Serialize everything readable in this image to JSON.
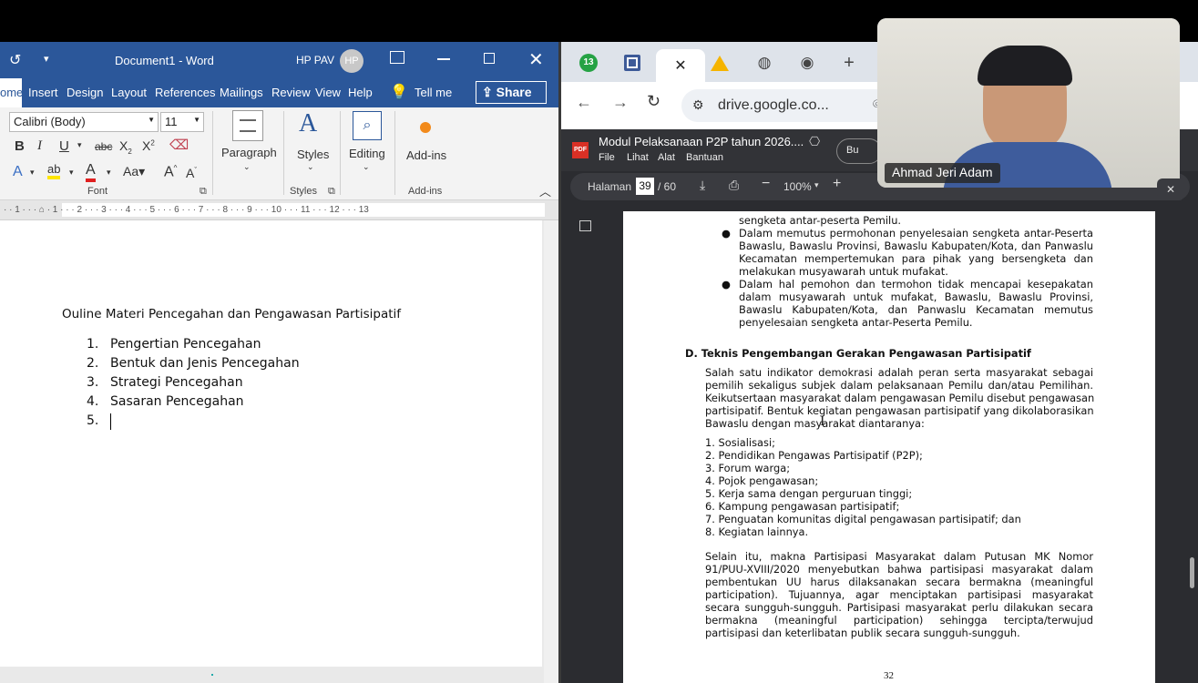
{
  "word": {
    "title": "Document1  -  Word",
    "user": "HP PAV",
    "avatar": "HP",
    "tabs": [
      "ome",
      "Insert",
      "Design",
      "Layout",
      "References",
      "Mailings",
      "Review",
      "View",
      "Help"
    ],
    "tell_me": "Tell me",
    "share": "Share",
    "font_name": "Calibri (Body)",
    "font_size": "11",
    "paragraph_label": "Paragraph",
    "styles_label": "Styles",
    "editing_label": "Editing",
    "addins_label": "Add-ins",
    "group_font": "Font",
    "group_styles": "Styles",
    "group_addins": "Add-ins",
    "ruler": "· · 1 · · · ⌂ · 1 · · · 2 · · · 3 · · · 4 · · · 5 · · · 6 · · · 7 · · · 8 · · · 9 · · · 10 · · · 11 · · · 12 · · · 13",
    "doc": {
      "heading": "Ouline Materi Pencegahan dan Pengawasan Partisipatif",
      "items": [
        {
          "n": "1.",
          "t": "Pengertian Pencegahan"
        },
        {
          "n": "2.",
          "t": "Bentuk dan Jenis Pencegahan"
        },
        {
          "n": "3.",
          "t": "Strategi Pencegahan"
        },
        {
          "n": "4.",
          "t": "Sasaran Pencegahan"
        },
        {
          "n": "5.",
          "t": ""
        }
      ]
    }
  },
  "chrome": {
    "tab_badge": "13",
    "url": "drive.google.co...",
    "pdf_title": "Modul Pelaksanaan P2P tahun 2026....",
    "pdf_menu": [
      "File",
      "Lihat",
      "Alat",
      "Bantuan"
    ],
    "pdf_btn": "Bu",
    "halaman_label": "Halaman",
    "page_current": "39",
    "page_total": "/ 60",
    "zoom": "100%",
    "page": {
      "top_lines": [
        "sengketa antar-peserta Pemilu.",
        "Dalam memutus permohonan penyelesaian sengketa antar-Peserta",
        "Bawaslu, Bawaslu Provinsi, Bawaslu Kabupaten/Kota, dan Panwaslu",
        "Kecamatan mempertemukan para pihak yang bersengketa dan",
        "melakukan musyawarah untuk mufakat.",
        "Dalam hal pemohon dan termohon tidak mencapai kesepakatan",
        "dalam musyawarah untuk mufakat, Bawaslu, Bawaslu Provinsi,",
        "Bawaslu Kabupaten/Kota, dan Panwaslu Kecamatan memutus",
        "penyelesaian sengketa antar-Peserta Pemilu."
      ],
      "section_heading": "D.  Teknis Pengembangan Gerakan Pengawasan Partisipatif",
      "para1": [
        "Salah satu indikator demokrasi adalah peran serta masyarakat sebagai",
        "pemilih sekaligus subjek dalam pelaksanaan Pemilu dan/atau Pemilihan.",
        "Keikutsertaan masyarakat dalam pengawasan Pemilu disebut pengawasan",
        "partisipatif. Bentuk kegiatan pengawasan partisipatif yang dikolaborasikan",
        "Bawaslu dengan masyarakat diantaranya:"
      ],
      "list": [
        "1. Sosialisasi;",
        "2. Pendidikan Pengawas Partisipatif (P2P);",
        "3. Forum warga;",
        "4. Pojok pengawasan;",
        "5. Kerja sama dengan perguruan tinggi;",
        "6. Kampung pengawasan partisipatif;",
        "7. Penguatan komunitas digital pengawasan partisipatif; dan",
        "8. Kegiatan lainnya."
      ],
      "para2": [
        "Selain itu, makna Partisipasi Masyarakat dalam Putusan MK Nomor",
        "91/PUU-XVIII/2020 menyebutkan bahwa partisipasi masyarakat dalam",
        "pembentukan UU harus dilaksanakan secara bermakna (meaningful",
        "participation). Tujuannya, agar menciptakan partisipasi masyarakat",
        "secara sungguh-sungguh. Partisipasi masyarakat perlu dilakukan secara",
        "bermakna (meaningful participation) sehingga tercipta/terwujud",
        "partisipasi dan keterlibatan publik secara sungguh-sungguh."
      ],
      "page_number": "32"
    }
  },
  "video": {
    "name": "Ahmad Jeri Adam"
  },
  "colors": {
    "word_blue": "#2b579a",
    "chrome_bg": "#dee3ea",
    "pdf_dark": "#2b2c30"
  }
}
